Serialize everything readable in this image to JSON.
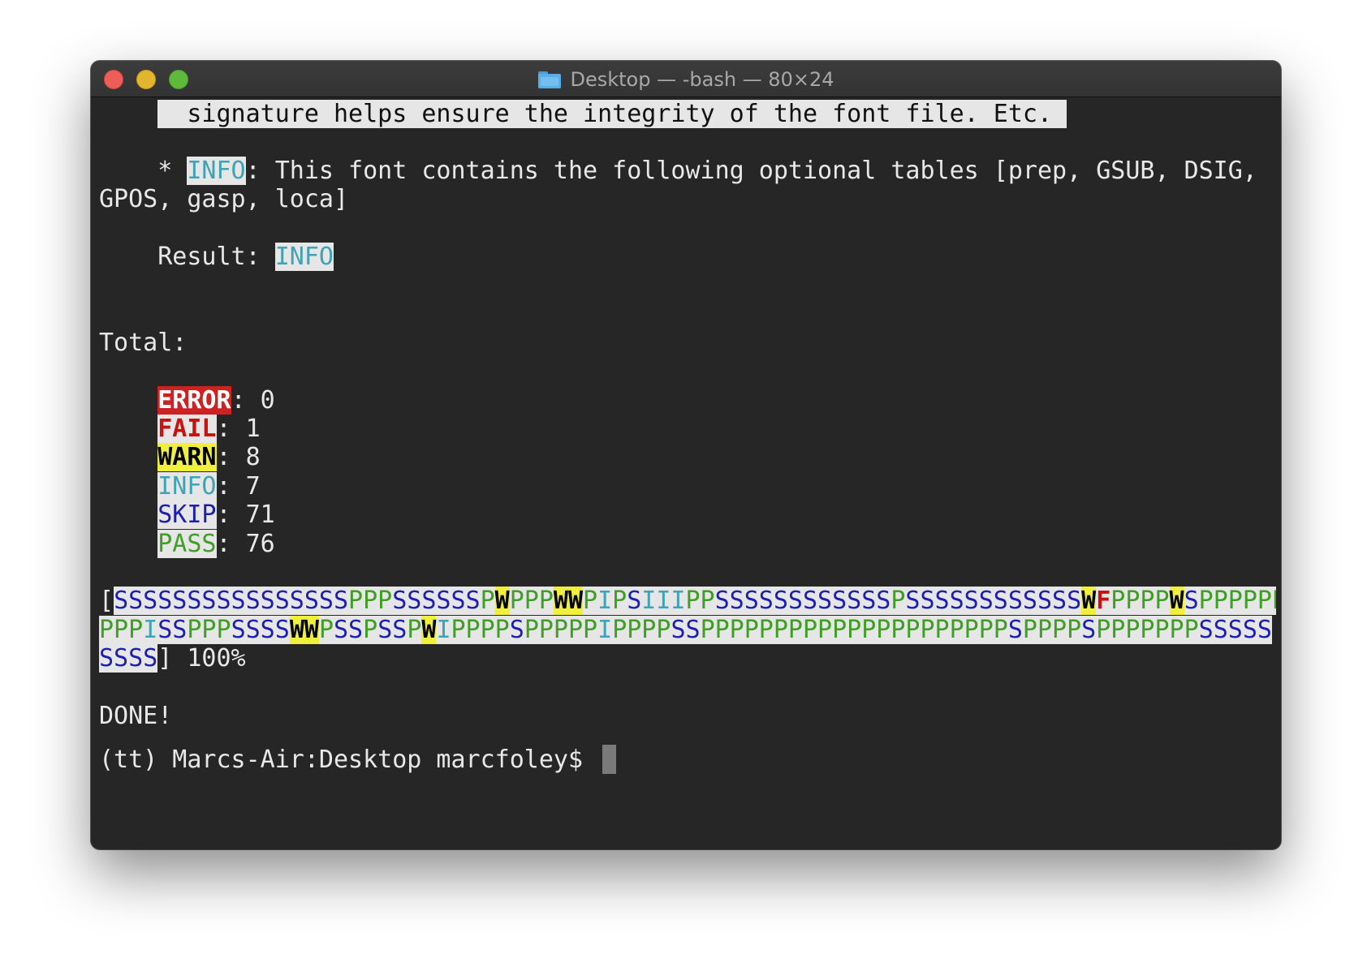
{
  "window": {
    "title": "Desktop — -bash — 80×24",
    "folder_icon": "folder-icon"
  },
  "terminal": {
    "sig_line": "  signature helps ensure the integrity of the font file. Etc. ",
    "info_bullet": "    * ",
    "info_tag": "INFO",
    "info_msg": ": This font contains the following optional tables [prep, GSUB, DSIG,",
    "info_msg2": "GPOS, gasp, loca]",
    "result_label": "    Result: ",
    "result_value": "INFO",
    "total_label": "Total:",
    "totals": {
      "error_label": "ERROR",
      "error_value": ": 0",
      "fail_label": "FAIL",
      "fail_value": ": 1",
      "warn_label": "WARN",
      "warn_value": ": 8",
      "info_label": "INFO",
      "info_value": ": 7",
      "skip_label": "SKIP",
      "skip_value": ": 71",
      "pass_label": "PASS",
      "pass_value": ": 76"
    },
    "progress": {
      "open_bracket": "[",
      "row1": [
        {
          "t": "SSSSSSSSSSSSSSSS",
          "k": "S"
        },
        {
          "t": "PPP",
          "k": "P"
        },
        {
          "t": "SSSSSS",
          "k": "S"
        },
        {
          "t": "P",
          "k": "P"
        },
        {
          "t": "W",
          "k": "W"
        },
        {
          "t": "PPP",
          "k": "P"
        },
        {
          "t": "WW",
          "k": "W"
        },
        {
          "t": "P",
          "k": "P"
        },
        {
          "t": "I",
          "k": "I"
        },
        {
          "t": "P",
          "k": "P"
        },
        {
          "t": "S",
          "k": "S"
        },
        {
          "t": "III",
          "k": "I"
        },
        {
          "t": "PP",
          "k": "P"
        },
        {
          "t": "SSSSSSSSSSSS",
          "k": "S"
        },
        {
          "t": "P",
          "k": "P"
        },
        {
          "t": "SSSSSSSSSSSS",
          "k": "S"
        },
        {
          "t": "W",
          "k": "W"
        },
        {
          "t": "F",
          "k": "F"
        },
        {
          "t": "PPPP",
          "k": "P"
        },
        {
          "t": "W",
          "k": "W"
        },
        {
          "t": "S",
          "k": "S"
        },
        {
          "t": "PPPPPP",
          "k": "P"
        }
      ],
      "row2": [
        {
          "t": "PPP",
          "k": "P"
        },
        {
          "t": "I",
          "k": "I"
        },
        {
          "t": "SS",
          "k": "S"
        },
        {
          "t": "PPP",
          "k": "P"
        },
        {
          "t": "SSSS",
          "k": "S"
        },
        {
          "t": "WW",
          "k": "W"
        },
        {
          "t": "P",
          "k": "P"
        },
        {
          "t": "SS",
          "k": "S"
        },
        {
          "t": "P",
          "k": "P"
        },
        {
          "t": "SS",
          "k": "S"
        },
        {
          "t": "P",
          "k": "P"
        },
        {
          "t": "W",
          "k": "W"
        },
        {
          "t": "I",
          "k": "I"
        },
        {
          "t": "PPPP",
          "k": "P"
        },
        {
          "t": "S",
          "k": "S"
        },
        {
          "t": "PPPPP",
          "k": "P"
        },
        {
          "t": "I",
          "k": "I"
        },
        {
          "t": "PPPP",
          "k": "P"
        },
        {
          "t": "SS",
          "k": "S"
        },
        {
          "t": "PPPPPPPPPPPPPPPPPPPPP",
          "k": "P"
        },
        {
          "t": "S",
          "k": "S"
        },
        {
          "t": "PPPP",
          "k": "P"
        },
        {
          "t": "S",
          "k": "S"
        },
        {
          "t": "PPPPPPP",
          "k": "P"
        },
        {
          "t": "SSSSS",
          "k": "S"
        }
      ],
      "row3": [
        {
          "t": "SSSS",
          "k": "S"
        }
      ],
      "close_bracket": "]",
      "percent": " 100%"
    },
    "done": "DONE!",
    "prompt": "(tt) Marcs-Air:Desktop marcfoley$ "
  },
  "colors": {
    "background": "#262626",
    "error_bg": "#cc2222",
    "fail": "#cc1010",
    "warn_bg": "#f0ef3c",
    "info": "#3ea3b4",
    "skip": "#1d1fb3",
    "pass": "#3f9f25",
    "selection": "#e6e6e6"
  }
}
